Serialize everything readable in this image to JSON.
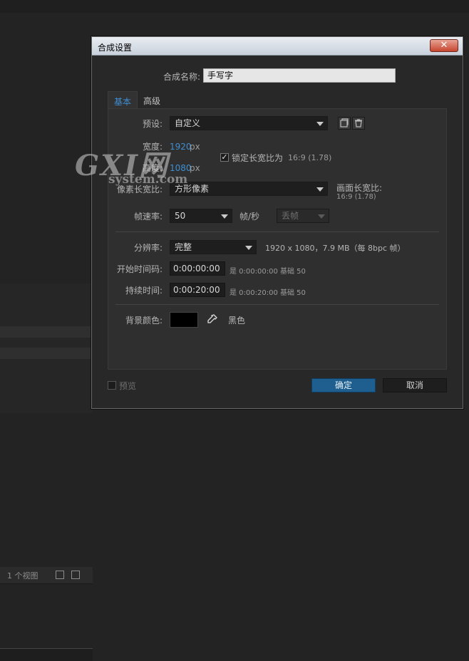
{
  "background": {
    "viewbar_label": "1 个视图"
  },
  "dialog": {
    "title": "合成设置",
    "close_label": "✕",
    "name_label": "合成名称:",
    "name_value": "手写字",
    "tabs": [
      {
        "label": "基本",
        "active": true
      },
      {
        "label": "高级",
        "active": false
      }
    ],
    "preset": {
      "label": "预设:",
      "value": "自定义"
    },
    "width": {
      "label": "宽度:",
      "value": "1920",
      "unit": "px"
    },
    "height": {
      "label": "高度:",
      "value": "1080",
      "unit": "px"
    },
    "lock_aspect": {
      "label": "锁定长宽比为",
      "ratio": "16:9 (1.78)",
      "checked": true
    },
    "pixel_aspect": {
      "label": "像素长宽比:",
      "value": "方形像素"
    },
    "frame_aspect": {
      "label": "画面长宽比:",
      "value": "16:9 (1.78)"
    },
    "frame_rate": {
      "label": "帧速率:",
      "value": "50",
      "unit": "帧/秒",
      "drop_frame": "丢帧"
    },
    "resolution": {
      "label": "分辨率:",
      "value": "完整",
      "info": "1920 x 1080，7.9 MB（每 8bpc 帧）"
    },
    "start_timecode": {
      "label": "开始时间码:",
      "value": "0:00:00:00",
      "note": "是 0:00:00:00  基础 50"
    },
    "duration": {
      "label": "持续时间:",
      "value": "0:00:20:00",
      "note": "是 0:00:20:00  基础 50"
    },
    "bg_color": {
      "label": "背景颜色:",
      "color_name": "黑色",
      "color": "#000000"
    },
    "preview_label": "预览",
    "ok_label": "确定",
    "cancel_label": "取消"
  },
  "watermark": {
    "big": "GXI网",
    "small": "system.com"
  },
  "colors": {
    "accent": "#3e8fd2",
    "ok_button": "#1e5f8f"
  }
}
